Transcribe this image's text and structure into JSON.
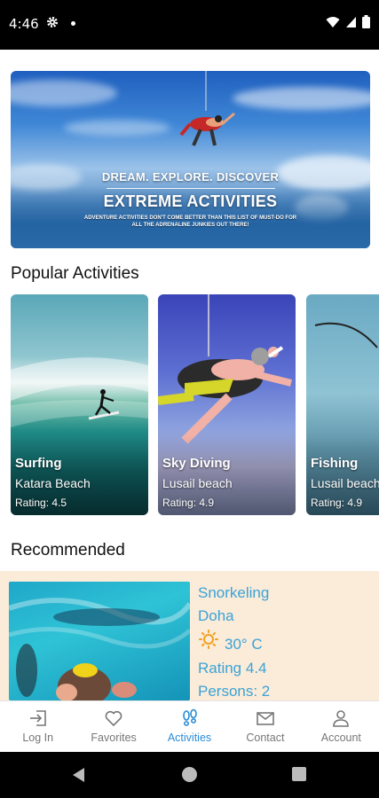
{
  "status_bar": {
    "time": "4:46"
  },
  "hero": {
    "line1": "DREAM. EXPLORE. DISCOVER",
    "line2": "EXTREME ACTIVITIES",
    "subtext": "ADVENTURE ACTIVITIES DON'T COME BETTER THAN THIS LIST OF MUST-DO FOR ALL THE ADRENALINE JUNKIES OUT THERE!"
  },
  "popular": {
    "title": "Popular Activities",
    "cards": [
      {
        "name": "Surfing",
        "location": "Katara Beach",
        "rating": "Rating: 4.5"
      },
      {
        "name": "Sky Diving",
        "location": "Lusail beach",
        "rating": "Rating: 4.9"
      },
      {
        "name": "Fishing",
        "location": "Lusail beach",
        "rating": "Rating: 4.9"
      }
    ]
  },
  "recommended": {
    "title": "Recommended",
    "item": {
      "name": "Snorkeling",
      "location": "Doha",
      "temperature": "30° C",
      "rating": "Rating 4.4",
      "persons": "Persons: 2"
    }
  },
  "bottom_nav": {
    "items": [
      {
        "label": "Log In",
        "icon": "login-icon"
      },
      {
        "label": "Favorites",
        "icon": "heart-icon"
      },
      {
        "label": "Activities",
        "icon": "footprints-icon"
      },
      {
        "label": "Contact",
        "icon": "mail-icon"
      },
      {
        "label": "Account",
        "icon": "person-icon"
      }
    ],
    "active_color": "#2b8cd6",
    "inactive_color": "#777777"
  },
  "colors": {
    "accent": "#3aa3d6",
    "recommended_bg": "#fbebd9",
    "sun": "#f2a01e"
  }
}
